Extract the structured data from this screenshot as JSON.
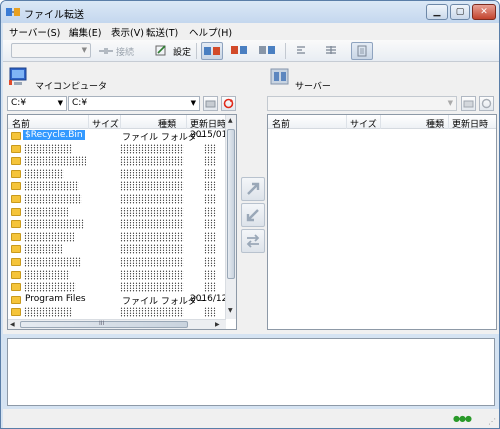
{
  "window": {
    "title": "ファイル転送",
    "controls": {
      "minimize": "▁",
      "maximize": "▢",
      "close": "✕"
    }
  },
  "menu": [
    {
      "label": "サーバー(S)"
    },
    {
      "label": "編集(E)"
    },
    {
      "label": "表示(V)"
    },
    {
      "label": "転送(T)"
    },
    {
      "label": "ヘルプ(H)"
    }
  ],
  "toolbar": {
    "connection_value": "",
    "connect_label": "接続",
    "settings_label": "設定",
    "buttons": [
      "view-local-remote-icon",
      "view-remote-local-icon",
      "view-split-icon",
      "align-left-icon",
      "align-columns-icon",
      "details-view-icon"
    ]
  },
  "local": {
    "title": "マイコンピュータ",
    "drive": "C:¥",
    "path": "C:¥",
    "columns": [
      "名前",
      "サイズ",
      "種類",
      "更新日時"
    ],
    "rows": [
      {
        "name": "$Recycle.Bin",
        "size": "",
        "type": "ファイル フォルダー",
        "date": "2015/01",
        "selected": true
      },
      {
        "name": "",
        "size": "",
        "type": "",
        "date": "",
        "obscured": true
      },
      {
        "name": "",
        "size": "",
        "type": "",
        "date": "",
        "obscured": true
      },
      {
        "name": "",
        "size": "",
        "type": "",
        "date": "",
        "obscured": true
      },
      {
        "name": "",
        "size": "",
        "type": "",
        "date": "",
        "obscured": true
      },
      {
        "name": "",
        "size": "",
        "type": "",
        "date": "",
        "obscured": true
      },
      {
        "name": "",
        "size": "",
        "type": "",
        "date": "",
        "obscured": true
      },
      {
        "name": "",
        "size": "",
        "type": "",
        "date": "",
        "obscured": true
      },
      {
        "name": "",
        "size": "",
        "type": "",
        "date": "",
        "obscured": true
      },
      {
        "name": "",
        "size": "",
        "type": "",
        "date": "",
        "obscured": true
      },
      {
        "name": "",
        "size": "",
        "type": "",
        "date": "",
        "obscured": true
      },
      {
        "name": "",
        "size": "",
        "type": "",
        "date": "",
        "obscured": true
      },
      {
        "name": "",
        "size": "",
        "type": "",
        "date": "",
        "obscured": true
      },
      {
        "name": "Program Files",
        "size": "",
        "type": "ファイル フォルダー",
        "date": "2016/12"
      },
      {
        "name": "",
        "size": "",
        "type": "",
        "date": "",
        "obscured": true
      }
    ]
  },
  "server": {
    "title": "サーバー",
    "path": "",
    "columns": [
      "名前",
      "サイズ",
      "種類",
      "更新日時"
    ],
    "rows": []
  },
  "scroll_glyphs": {
    "up": "▲",
    "down": "▼",
    "left": "◀",
    "right": "▶",
    "grip": "III"
  },
  "log": {
    "lines": []
  },
  "status": {
    "indicator": "●●●",
    "grip": "⋰"
  },
  "colors": {
    "selected_row": "#3399ff",
    "folder": "#f5c43a",
    "refresh_red": "#e02a1a"
  }
}
